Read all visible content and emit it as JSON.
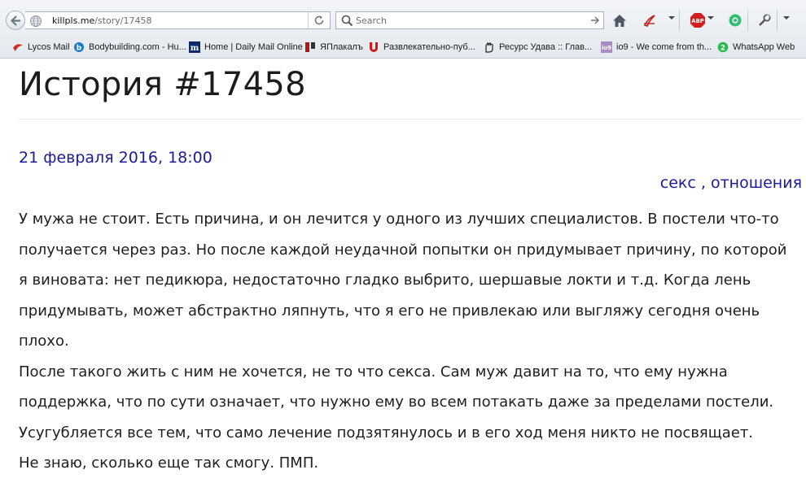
{
  "browser": {
    "url_host": "killpls.me",
    "url_path": "/story/17458",
    "search_placeholder": "Search"
  },
  "bookmarks": [
    {
      "label": "Lycos Mail",
      "icon": "lycos-icon"
    },
    {
      "label": "Bodybuilding.com - Hu...",
      "icon": "bodybuilding-icon"
    },
    {
      "label": "Home | Daily Mail Online",
      "icon": "dailymail-icon"
    },
    {
      "label": "ЯПлакалъ",
      "icon": "yaplakal-icon"
    },
    {
      "label": "Развлекательно-пуб...",
      "icon": "u-icon"
    },
    {
      "label": "Ресурс Удава :: Глав...",
      "icon": "udav-icon"
    },
    {
      "label": "io9 - We come from th...",
      "icon": "io9-icon"
    },
    {
      "label": "WhatsApp Web",
      "icon": "whatsapp-icon"
    }
  ],
  "toolbar": {
    "adblock_label": "ABP"
  },
  "page": {
    "title": "История #17458",
    "date": "21 февраля 2016, 18:00",
    "tag1": "секс",
    "tag_sep": " , ",
    "tag2": "отношения",
    "paragraph1": "У мужа не стоит. Есть причина, и он лечится у одного из лучших специалистов. В постели что-то\nполучается через раз. Но после каждой неудачной попытки он придумывает причину, по которой\nя виновата: нет педикюра, недостаточно гладко выбрито, шершавые локти и т.д. Когда лень\nпридумывать, может абстрактно ляпнуть, что я его не привлекаю или выгляжу сегодня очень\nплохо.",
    "paragraph2": "После такого жить с ним не хочется, не то что секса. Сам муж давит на то, что ему нужна\nподдержка, что по сути означает, что нужно ему во всем потакать даже за пределами постели.\nУсугубляется все тем, что само лечение подзятянулось и в его ход меня никто не посвящает.",
    "paragraph3": "Не знаю, сколько еще так смогу. ПМП."
  }
}
